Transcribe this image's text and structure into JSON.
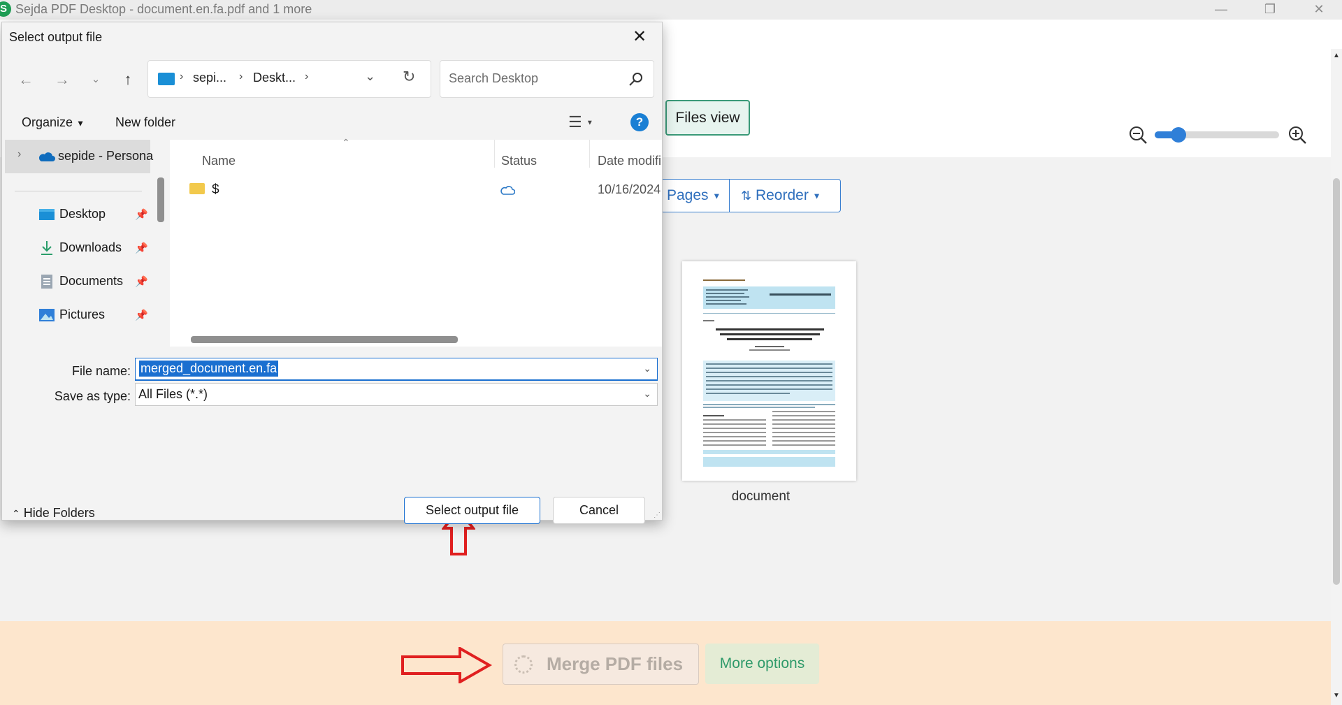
{
  "app": {
    "logo_letter": "S",
    "window_title": "Sejda PDF Desktop - document.en.fa.pdf and 1 more",
    "files_view_label": "Files view",
    "zoom_level": 0.19,
    "pages_label": "Pages",
    "reorder_label": "Reorder",
    "document_label": "document",
    "merge_label": "Merge PDF files",
    "more_options_label": "More options"
  },
  "dialog": {
    "title": "Select output file",
    "address": {
      "segment1": "sepi...",
      "segment2": "Deskt..."
    },
    "search_placeholder": "Search Desktop",
    "organize_label": "Organize",
    "new_folder_label": "New folder",
    "help_label": "?",
    "nav": {
      "selected": "sepide - Persona",
      "items": [
        {
          "label": "Desktop",
          "icon": "desktop-icon"
        },
        {
          "label": "Downloads",
          "icon": "download-icon"
        },
        {
          "label": "Documents",
          "icon": "documents-icon"
        },
        {
          "label": "Pictures",
          "icon": "pictures-icon"
        }
      ]
    },
    "columns": {
      "name": "Name",
      "status": "Status",
      "date": "Date modifi"
    },
    "files": [
      {
        "name": "$",
        "status_icon": "cloud-icon",
        "date": "10/16/2024"
      }
    ],
    "file_name_label": "File name:",
    "file_name_value": "merged_document.en.fa",
    "save_type_label": "Save as type:",
    "save_type_value": "All Files (*.*)",
    "hide_folders_label": "Hide Folders",
    "select_button_label": "Select output file",
    "cancel_button_label": "Cancel"
  },
  "colors": {
    "accent": "#1a6fd0",
    "annotation_arrow": "#e02020",
    "merge_bar": "#fde6cd",
    "files_view_bg": "#e7f4ef"
  }
}
